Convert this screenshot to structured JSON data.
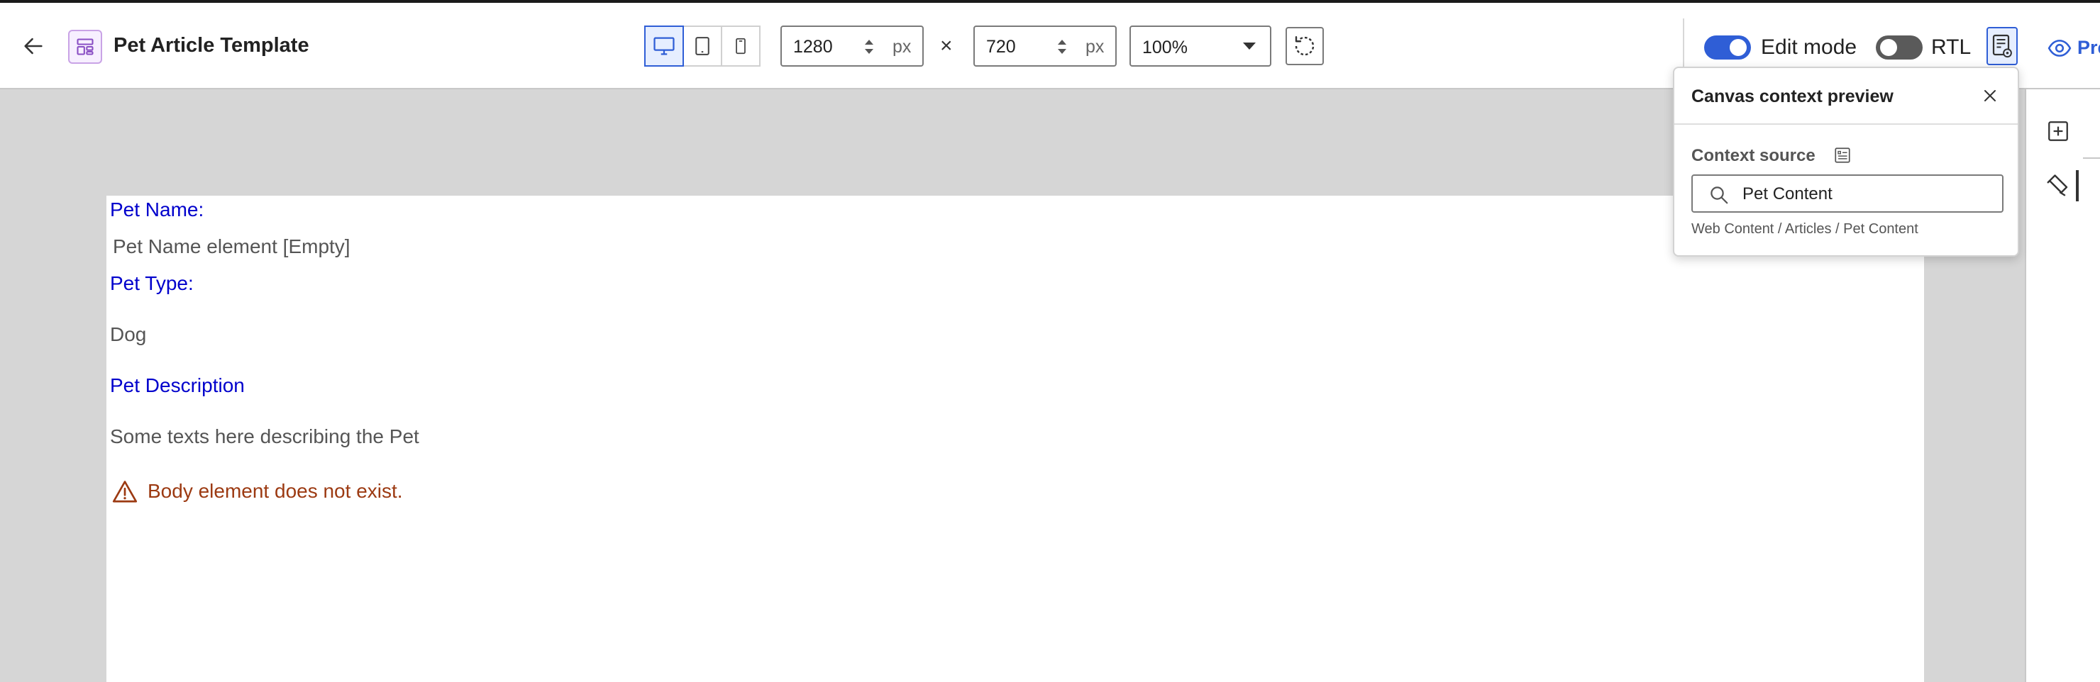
{
  "header": {
    "title": "Pet Article Template",
    "width_value": "1280",
    "height_value": "720",
    "unit": "px",
    "times": "×",
    "zoom": "100%",
    "edit_mode_label": "Edit mode",
    "edit_mode_on": true,
    "rtl_label": "RTL",
    "rtl_on": false,
    "preview_label": "Preview",
    "active_device": "desktop"
  },
  "canvas": {
    "pet_name_label": "Pet Name:",
    "pet_name_value": "Pet Name element [Empty]",
    "pet_type_label": "Pet Type:",
    "pet_type_value": "Dog",
    "pet_desc_label": "Pet Description",
    "pet_desc_value": "Some texts here describing the Pet",
    "warning": "Body element does not exist."
  },
  "popover": {
    "title": "Canvas context preview",
    "context_source_label": "Context source",
    "search_value": "Pet Content",
    "path": "Web Content / Articles / Pet Content"
  },
  "colors": {
    "accent": "#2f5ed6",
    "field_label": "#0000cc",
    "warning": "#9c3a12"
  },
  "icons": [
    "arrow-left-icon",
    "template-icon",
    "desktop-icon",
    "tablet-icon",
    "mobile-icon",
    "rotate-icon",
    "context-preview-icon",
    "eye-icon",
    "close-icon",
    "list-icon",
    "search-icon",
    "plus-icon",
    "brush-icon",
    "warning-icon"
  ]
}
